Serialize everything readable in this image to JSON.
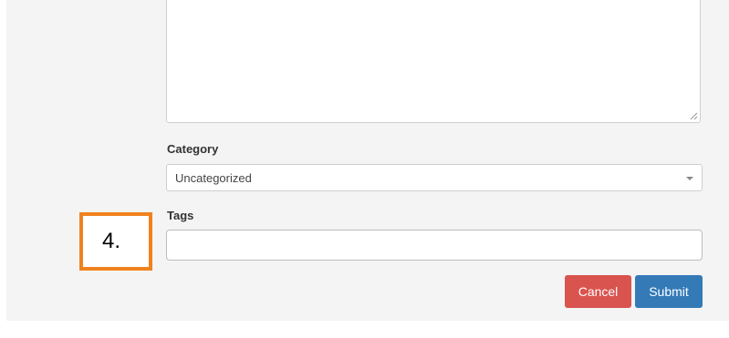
{
  "form": {
    "category": {
      "label": "Category",
      "selected": "Uncategorized"
    },
    "tags": {
      "label": "Tags",
      "value": "",
      "placeholder": ""
    },
    "buttons": {
      "cancel": "Cancel",
      "submit": "Submit"
    }
  },
  "annotation": {
    "step": "4."
  },
  "colors": {
    "cancel": "#d9534f",
    "submit": "#337ab7",
    "annotation_border": "#f0821e",
    "panel_background": "#f4f4f4"
  },
  "icons": {
    "select_caret": "chevron-down-icon",
    "textarea_grip": "resize-grip-icon"
  }
}
